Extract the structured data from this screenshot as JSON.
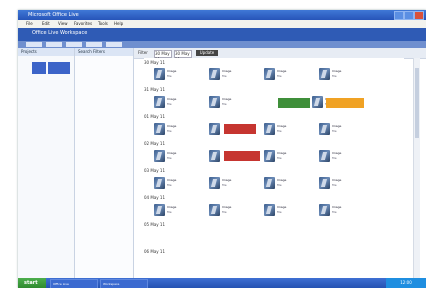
{
  "window": {
    "title": "Microsoft Office Live"
  },
  "menu": [
    "File",
    "Edit",
    "View",
    "Favorites",
    "Tools",
    "Help"
  ],
  "header": {
    "title": "Office Live Workspace"
  },
  "left_panel": {
    "title": "Projects"
  },
  "mid_panel": {
    "title": "Search Filters"
  },
  "filter_toolbar": {
    "label": "Filter",
    "fields": [
      "30 May 11",
      "30 May 11"
    ],
    "button": "Update"
  },
  "timeline": {
    "dates": [
      "30 May 11",
      "31 May 11",
      "01 May 11",
      "02 May 11",
      "03 May 11",
      "04 May 11",
      "05 May 11",
      "06 May 11"
    ],
    "rows": [
      {
        "items": [
          {
            "t1": "Image",
            "t2": "file"
          },
          {
            "t1": "Image",
            "t2": "file"
          },
          {
            "t1": "Image",
            "t2": "file"
          },
          {
            "t1": "Image",
            "t2": "file"
          }
        ]
      },
      {
        "items": [
          {
            "t1": "Image",
            "t2": "file"
          },
          {
            "t1": "Image",
            "t2": "file"
          },
          {
            "t1": "Image",
            "t2": "file"
          },
          {
            "t1": "Image",
            "t2": "file"
          }
        ]
      },
      {
        "items": [
          {
            "t1": "Image",
            "t2": "file"
          },
          {
            "t1": "Image",
            "t2": "file"
          },
          {
            "t1": "Image",
            "t2": "file"
          },
          {
            "t1": "Image",
            "t2": "file"
          }
        ]
      },
      {
        "items": [
          {
            "t1": "Image",
            "t2": "file"
          },
          {
            "t1": "Image",
            "t2": "file"
          },
          {
            "t1": "Image",
            "t2": "file"
          },
          {
            "t1": "Image",
            "t2": "file"
          }
        ]
      },
      {
        "items": [
          {
            "t1": "Image",
            "t2": "file"
          },
          {
            "t1": "Image",
            "t2": "file"
          },
          {
            "t1": "Image",
            "t2": "file"
          },
          {
            "t1": "Image",
            "t2": "file"
          }
        ]
      },
      {
        "items": [
          {
            "t1": "Image",
            "t2": "file"
          },
          {
            "t1": "Image",
            "t2": "file"
          },
          {
            "t1": "Image",
            "t2": "file"
          },
          {
            "t1": "Image",
            "t2": "file"
          }
        ]
      }
    ],
    "colors": {
      "green": "#3f8f3a",
      "orange": "#f0a224",
      "red": "#c63530"
    }
  },
  "taskbar": {
    "start": "start",
    "tasks": [
      "Office Live",
      "Workspace"
    ],
    "clock": "12:00"
  }
}
